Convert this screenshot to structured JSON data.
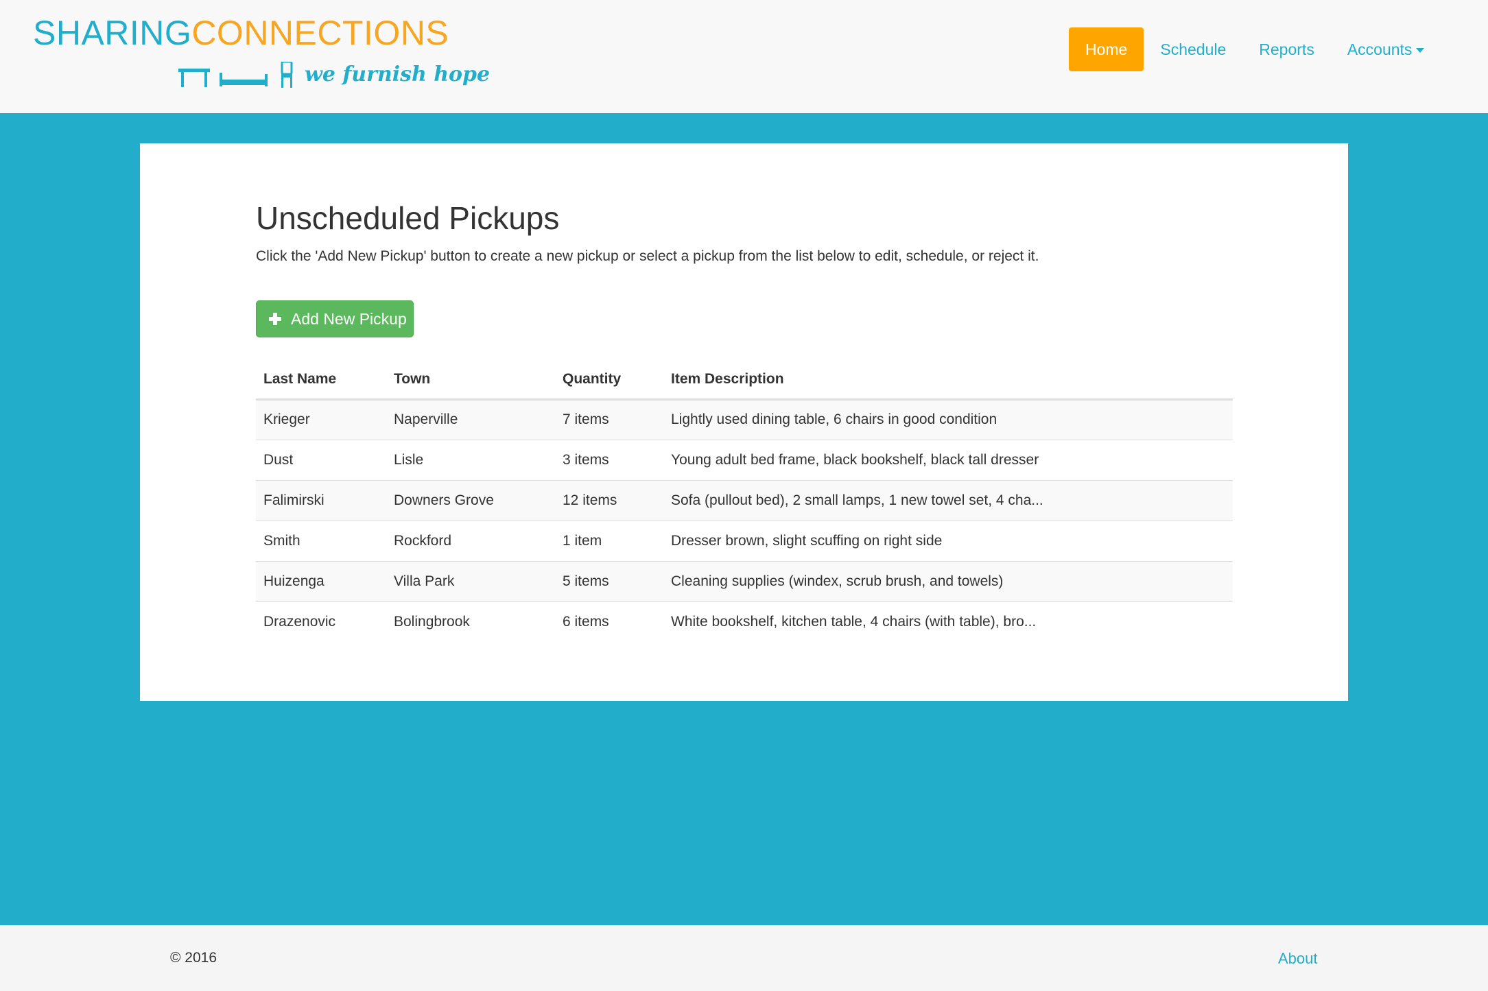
{
  "brand": {
    "word1": "SHARING",
    "word2": "CONNECTIONS",
    "tagline": "we furnish hope",
    "color_primary": "#22aeca",
    "color_secondary": "#f6a623"
  },
  "nav": {
    "items": [
      {
        "label": "Home",
        "active": true
      },
      {
        "label": "Schedule",
        "active": false
      },
      {
        "label": "Reports",
        "active": false
      },
      {
        "label": "Accounts",
        "active": false,
        "dropdown": true
      }
    ],
    "active_color": "#ffa500"
  },
  "main": {
    "title": "Unscheduled Pickups",
    "description": "Click the 'Add New Pickup' button to create a new pickup or select a pickup from the list below to edit, schedule, or reject it.",
    "add_button_label": "Add New Pickup",
    "add_button_icon": "plus-icon",
    "add_button_color": "#5cb85c"
  },
  "table": {
    "headers": [
      "Last Name",
      "Town",
      "Quantity",
      "Item Description"
    ],
    "rows": [
      [
        "Krieger",
        "Naperville",
        "7 items",
        "Lightly used dining table, 6 chairs in good condition"
      ],
      [
        "Dust",
        "Lisle",
        "3 items",
        "Young adult bed frame, black bookshelf, black tall dresser"
      ],
      [
        "Falimirski",
        "Downers Grove",
        "12 items",
        "Sofa (pullout bed), 2 small lamps, 1 new towel set, 4 cha..."
      ],
      [
        "Smith",
        "Rockford",
        "1 item",
        "Dresser brown, slight scuffing on right side"
      ],
      [
        "Huizenga",
        "Villa Park",
        "5 items",
        "Cleaning supplies (windex, scrub brush, and towels)"
      ],
      [
        "Drazenovic",
        "Bolingbrook",
        "6 items",
        "White bookshelf, kitchen table, 4 chairs (with table), bro..."
      ]
    ]
  },
  "footer": {
    "copyright": "© 2016",
    "about_label": "About"
  }
}
